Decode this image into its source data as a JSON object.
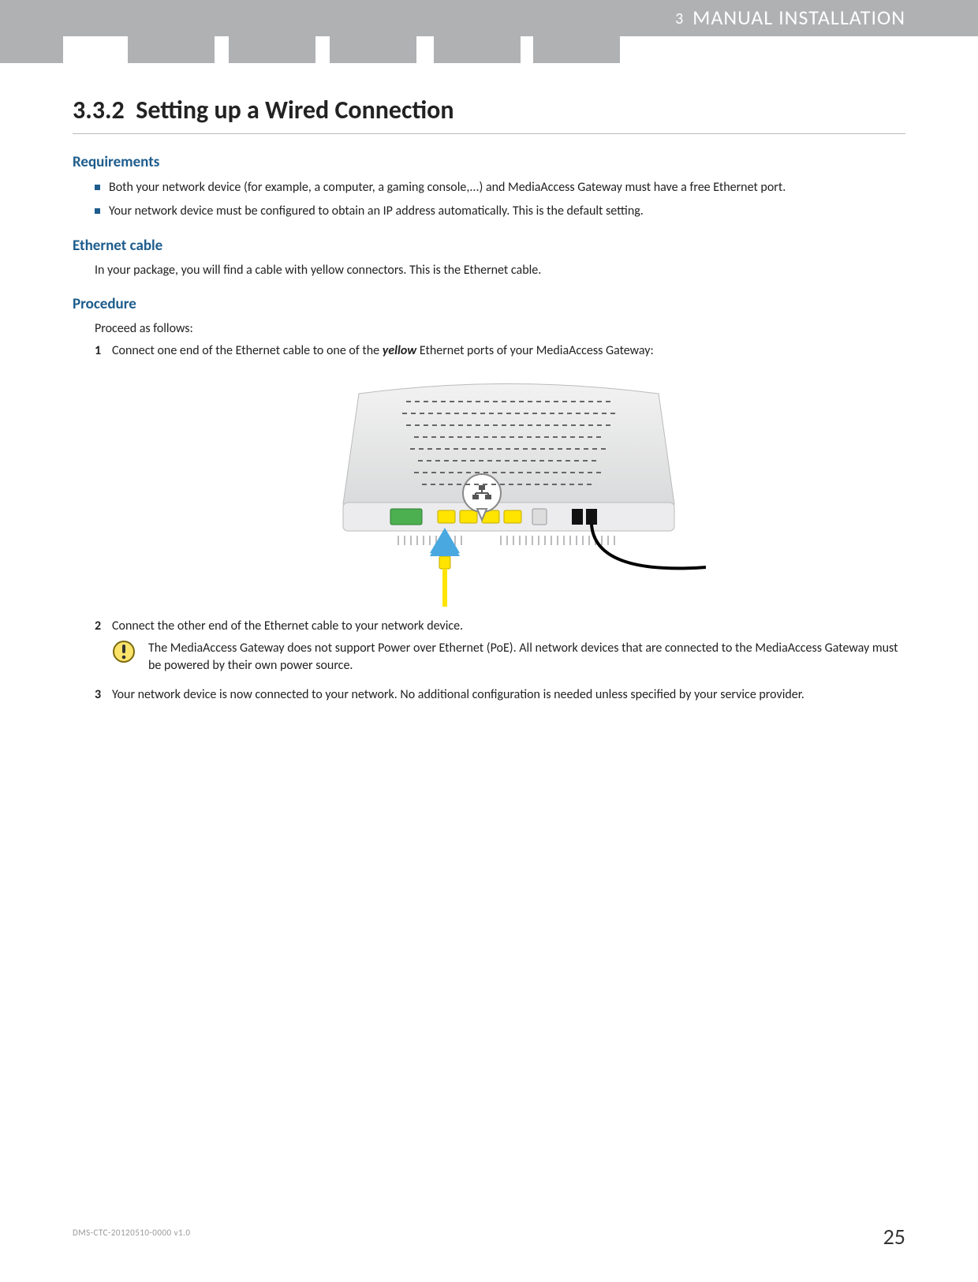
{
  "header": {
    "chapter_number": "3",
    "chapter_title": "MANUAL INSTALLATION"
  },
  "section": {
    "number": "3.3.2",
    "title": "Setting up a Wired Connection"
  },
  "requirements": {
    "heading": "Requirements",
    "items": [
      "Both your network device (for example, a computer, a gaming console,...) and MediaAccess Gateway must have a free Ethernet port.",
      "Your network device must be configured to obtain an IP address automatically. This is the default setting."
    ]
  },
  "ethernet_cable": {
    "heading": "Ethernet cable",
    "text": "In your package, you will find a cable with yellow connectors. This is the Ethernet cable."
  },
  "procedure": {
    "heading": "Procedure",
    "intro": "Proceed as follows:",
    "steps": {
      "s1_num": "1",
      "s1_a": "Connect one end of the Ethernet cable to one of the ",
      "s1_b": "yellow",
      "s1_c": " Ethernet ports of your MediaAccess Gateway:",
      "s2_num": "2",
      "s2_text": "Connect the other end of the Ethernet cable to your network device.",
      "s2_note": "The MediaAccess Gateway does not support Power over Ethernet (PoE). All network devices that are connected to the MediaAccess Gateway must be powered by their own power source.",
      "s3_num": "3",
      "s3_text": "Your network device is now connected to your network. No additional configuration is needed unless specified by your service provider."
    }
  },
  "footer": {
    "doc_id": "DMS-CTC-20120510-0000 v1.0",
    "page_number": "25"
  }
}
